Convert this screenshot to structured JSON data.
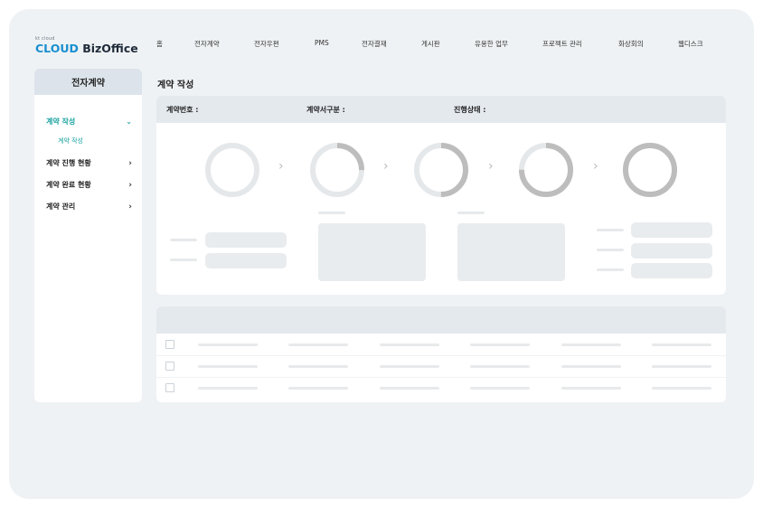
{
  "logo": {
    "small": "kt cloud",
    "cloud": "CLOUD",
    "biz": "BizOffice"
  },
  "topnav": {
    "items": [
      {
        "label": "홈"
      },
      {
        "label": "전자계약"
      },
      {
        "label": "전자우편"
      },
      {
        "label": "PMS"
      },
      {
        "label": "전자결재"
      },
      {
        "label": "게시판"
      },
      {
        "label": "유용한 업무"
      },
      {
        "label": "프로젝트 관리"
      },
      {
        "label": "화상회의"
      },
      {
        "label": "웹디스크"
      }
    ]
  },
  "sidebar": {
    "title": "전자계약",
    "items": [
      {
        "label": "계약 작성",
        "chevron": "chevron-down-icon"
      },
      {
        "label": "계약 작성"
      },
      {
        "label": "계약 진행 현황",
        "chevron": "chevron-right-icon"
      },
      {
        "label": "계약 완료 현황",
        "chevron": "chevron-right-icon"
      },
      {
        "label": "계약 관리",
        "chevron": "chevron-right-icon"
      }
    ]
  },
  "main": {
    "title": "계약 작성",
    "fields": [
      {
        "label": "계약번호 :"
      },
      {
        "label": "계약서구분 :"
      },
      {
        "label": "진행상태 :"
      }
    ],
    "progress_steps": [
      {
        "progress": 0
      },
      {
        "progress": 0.25
      },
      {
        "progress": 0.5
      },
      {
        "progress": 0.75
      },
      {
        "progress": 1
      }
    ]
  },
  "colors": {
    "accent": "#1aa3a0",
    "ring_track": "#e5e8ea",
    "ring_fill": "#bdbdbd"
  }
}
